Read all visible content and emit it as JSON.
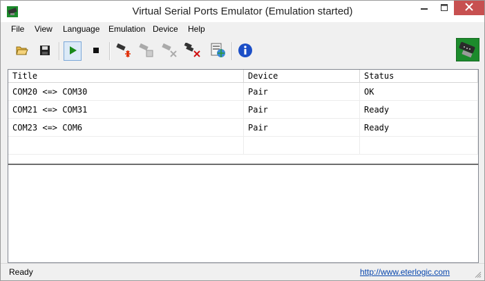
{
  "window": {
    "title": "Virtual Serial Ports Emulator (Emulation started)",
    "icons": {
      "app": "serial-port-icon",
      "minimize": "minimize-icon",
      "maximize": "maximize-icon",
      "close": "close-icon"
    }
  },
  "menu": [
    "File",
    "View",
    "Language",
    "Emulation",
    "Device",
    "Help"
  ],
  "toolbar": {
    "buttons": [
      {
        "name": "open-button",
        "icon": "open-folder-icon"
      },
      {
        "name": "save-button",
        "icon": "floppy-disk-icon"
      },
      {
        "name": "start-emulation-button",
        "icon": "play-icon",
        "active": true
      },
      {
        "name": "stop-emulation-button",
        "icon": "stop-icon"
      },
      {
        "name": "create-device-button",
        "icon": "new-device-icon"
      },
      {
        "name": "edit-device-button",
        "icon": "edit-device-icon",
        "disabled": true
      },
      {
        "name": "delete-device-button",
        "icon": "delete-device-icon",
        "disabled": true
      },
      {
        "name": "delete-all-devices-button",
        "icon": "delete-all-icon"
      },
      {
        "name": "device-info-button",
        "icon": "web-device-icon"
      },
      {
        "name": "about-button",
        "icon": "info-icon"
      }
    ],
    "logo_icon": "serial-cable-logo-icon"
  },
  "list": {
    "columns": [
      "Title",
      "Device",
      "Status"
    ],
    "rows": [
      [
        "COM20 <=> COM30",
        "Pair",
        "OK"
      ],
      [
        "COM21 <=> COM31",
        "Pair",
        "Ready"
      ],
      [
        "COM23 <=> COM6",
        "Pair",
        "Ready"
      ]
    ]
  },
  "status": {
    "text": "Ready",
    "link": "http://www.eterlogic.com"
  },
  "colors": {
    "close_button": "#c75050",
    "play_green": "#1a8a1a",
    "info_blue": "#1c4fc7",
    "link": "#0645ad"
  }
}
